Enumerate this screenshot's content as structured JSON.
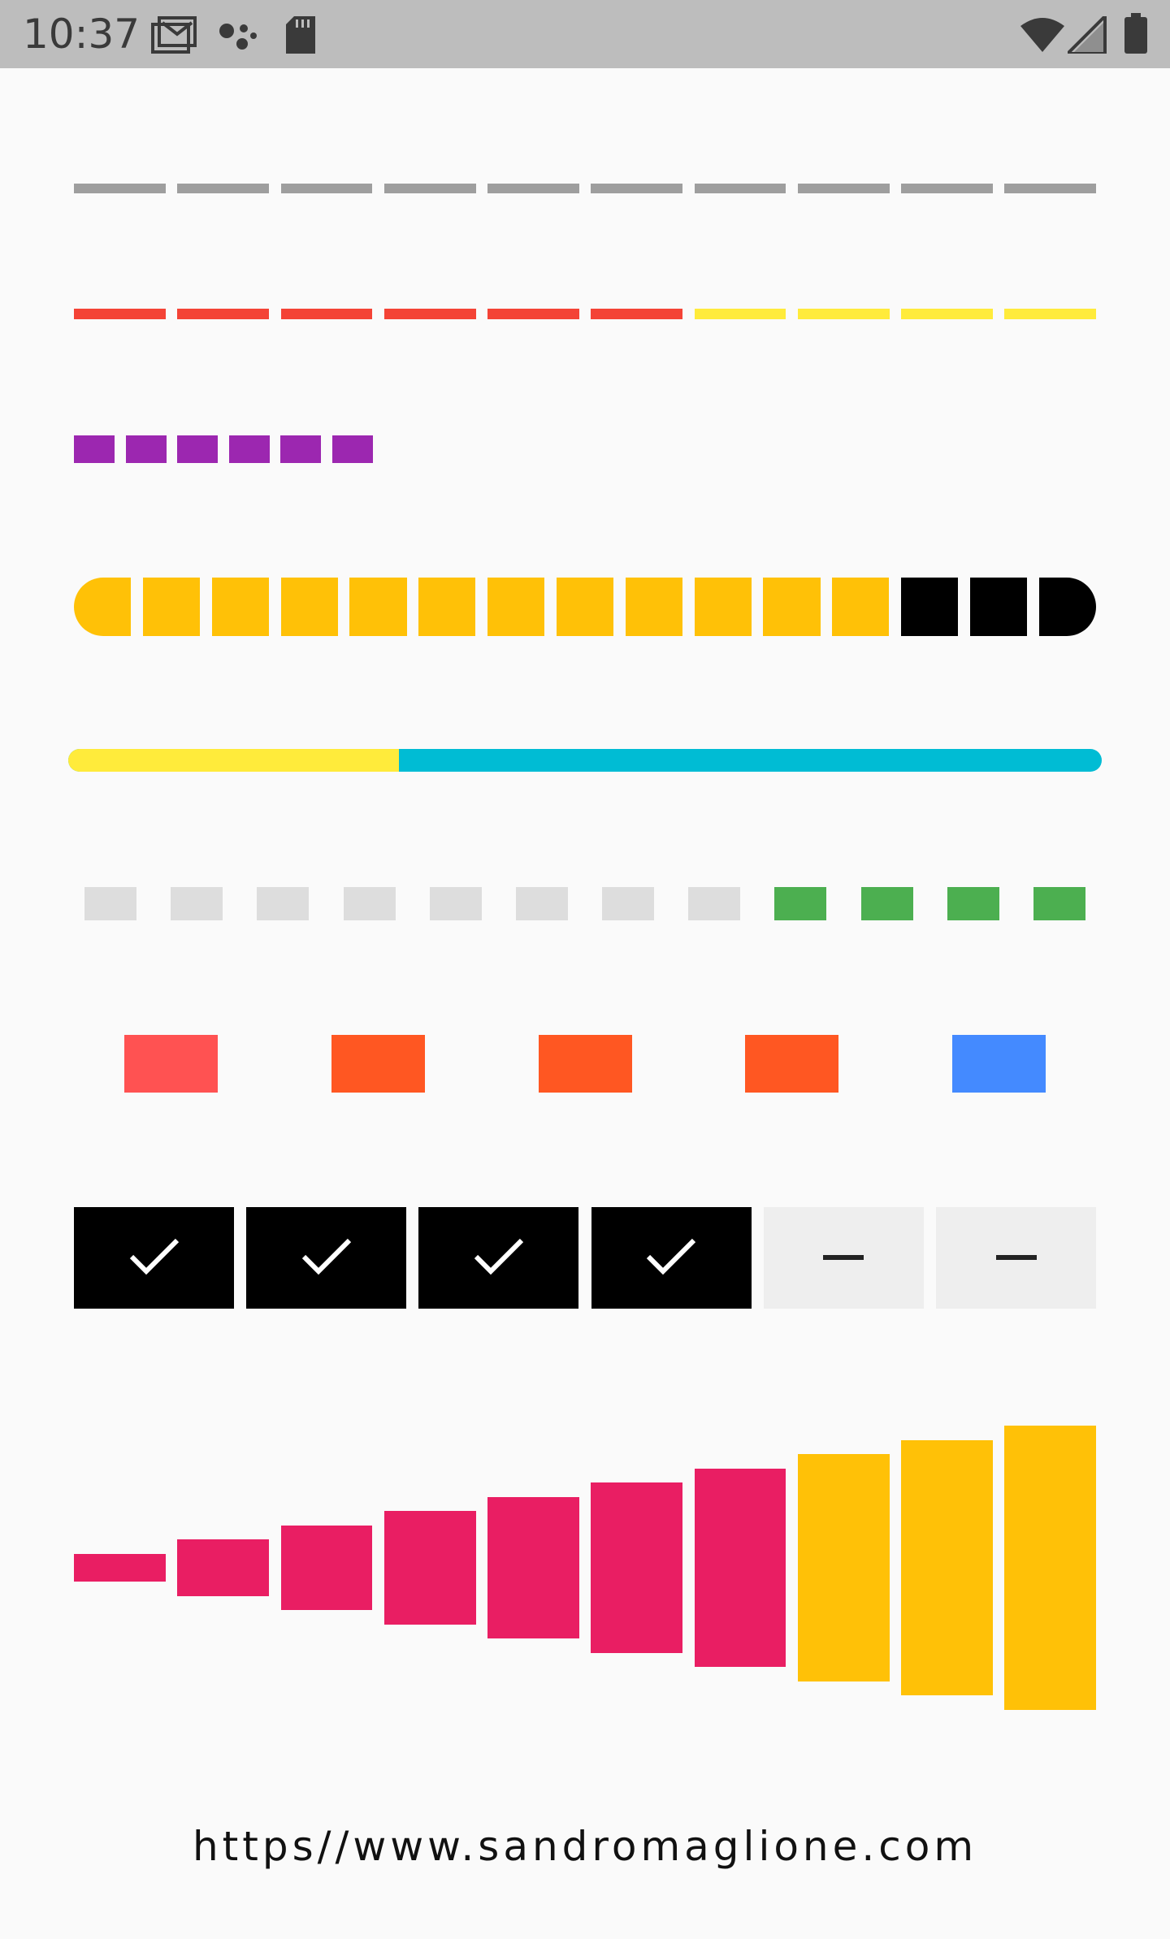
{
  "status_bar": {
    "time": "10:37",
    "left_icons": [
      "gmail-icon",
      "assistant-icon",
      "sd-card-icon"
    ],
    "right_icons": [
      "wifi-icon",
      "cellular-icon",
      "battery-icon"
    ]
  },
  "progress_rows": [
    {
      "name": "gray-dashes",
      "total": 10,
      "completed": 0,
      "completed_color": "#9e9e9e",
      "remaining_color": "#9e9e9e"
    },
    {
      "name": "red-yellow-dashes",
      "total": 10,
      "completed": 6,
      "completed_color": "#f44336",
      "remaining_color": "#ffeb3b"
    },
    {
      "name": "purple-squares",
      "total": 6,
      "completed": 6,
      "completed_color": "#9c27b0",
      "remaining_color": "#9c27b0"
    },
    {
      "name": "yellow-black-rounded",
      "total": 15,
      "completed": 12,
      "completed_color": "#ffc107",
      "remaining_color": "#000000"
    },
    {
      "name": "continuous-bar",
      "progress": 0.32,
      "completed_color": "#ffeb3b",
      "remaining_color": "#00bcd4"
    },
    {
      "name": "gray-green-blocks",
      "total": 12,
      "completed": 8,
      "completed_color": "#dddddd",
      "remaining_color": "#4caf50"
    },
    {
      "name": "spaced-blocks",
      "total": 5,
      "colors": [
        "#ff5252",
        "#ff5722",
        "#ff5722",
        "#ff5722",
        "#448aff"
      ]
    },
    {
      "name": "check-steps",
      "total": 6,
      "completed": 4,
      "completed_color": "#000000",
      "remaining_color": "#eeeeee"
    },
    {
      "name": "growing-bars",
      "total": 10,
      "completed": 7,
      "completed_color": "#e91e63",
      "remaining_color": "#ffc107"
    }
  ],
  "footer": {
    "url": "https//www.sandromaglione.com"
  }
}
